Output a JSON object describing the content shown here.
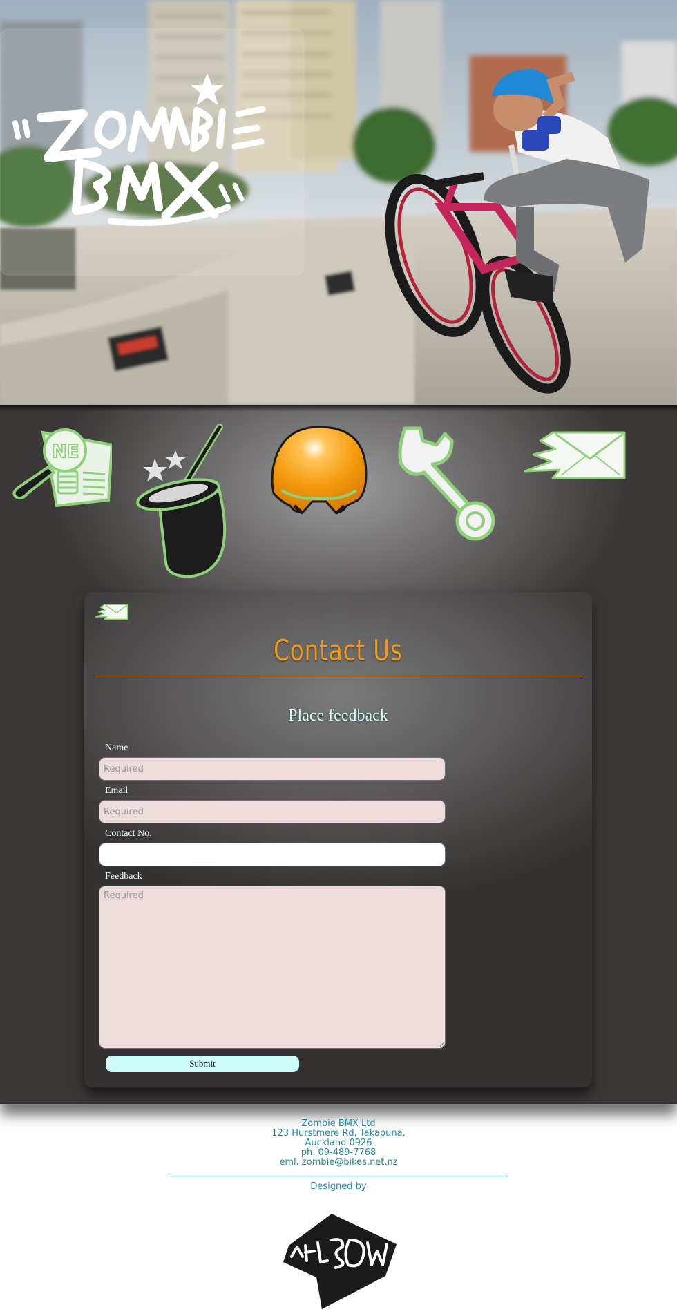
{
  "hero": {
    "logo_text": "\"ZOMBIE BMX\"",
    "logo_icon": "graffiti-logo"
  },
  "nav": {
    "items": [
      {
        "name": "news",
        "icon": "newspaper-magnifier-icon"
      },
      {
        "name": "magic",
        "icon": "magic-hat-icon"
      },
      {
        "name": "gear",
        "icon": "helmet-icon"
      },
      {
        "name": "service",
        "icon": "wrench-icon"
      },
      {
        "name": "contact",
        "icon": "mail-icon"
      }
    ]
  },
  "contact": {
    "title": "Contact Us",
    "form_heading": "Place feedback",
    "fields": {
      "name_label": "Name",
      "name_placeholder": "Required",
      "email_label": "Email",
      "email_placeholder": "Required",
      "phone_label": "Contact No.",
      "phone_placeholder": "",
      "feedback_label": "Feedback",
      "feedback_placeholder": "Required"
    },
    "submit_label": "Submit"
  },
  "footer": {
    "company": "Zombie BMX Ltd",
    "address1": "123 Hurstmere Rd, Takapuna,",
    "address2": "Auckland 0926",
    "phone": "ph. 09-489-7768",
    "email": "eml. zombie@bikes.net.nz",
    "designed_by": "Designed by"
  },
  "colors": {
    "accent_orange": "#f29a16",
    "nav_icon_outline": "#8fd17a",
    "footer_text": "#1c8aa8",
    "input_bg": "#eedcdc",
    "submit_bg": "#ccfbfb"
  }
}
